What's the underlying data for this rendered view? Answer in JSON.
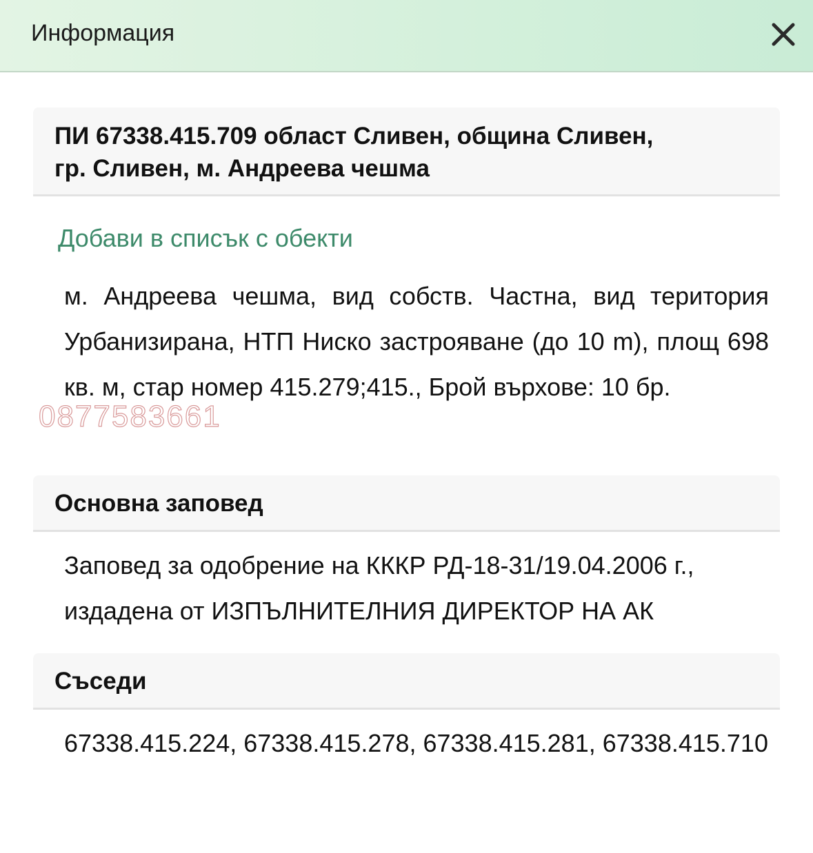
{
  "dialog": {
    "title": "Информация",
    "close_icon": "close-icon"
  },
  "property": {
    "title_line1": "ПИ 67338.415.709 област Сливен, община Сливен,",
    "title_line2": "гр. Сливен, м. Андреева чешма",
    "add_link": "Добави в списък с обекти",
    "description": "м. Андреева чешма, вид собств. Частна, вид територия Урбанизирана, НТП Ниско застрояване (до 10 m), площ 698 кв. м, стар номер 415.279;415., Брой върхове: 10 бр."
  },
  "watermark": "0877583661",
  "order": {
    "heading": "Основна заповед",
    "text": "Заповед за одобрение на КККР РД-18-31/19.04.2006 г., издадена от ИЗПЪЛНИТЕЛНИЯ ДИРЕКТОР НА АК"
  },
  "neighbors": {
    "heading": "Съседи",
    "text": "67338.415.224, 67338.415.278, 67338.415.281, 67338.415.710"
  },
  "colors": {
    "header_bg": "#d3f0db",
    "link": "#3d8a6a",
    "section_bg": "#f7f7f7",
    "watermark": "#d99a9a"
  }
}
